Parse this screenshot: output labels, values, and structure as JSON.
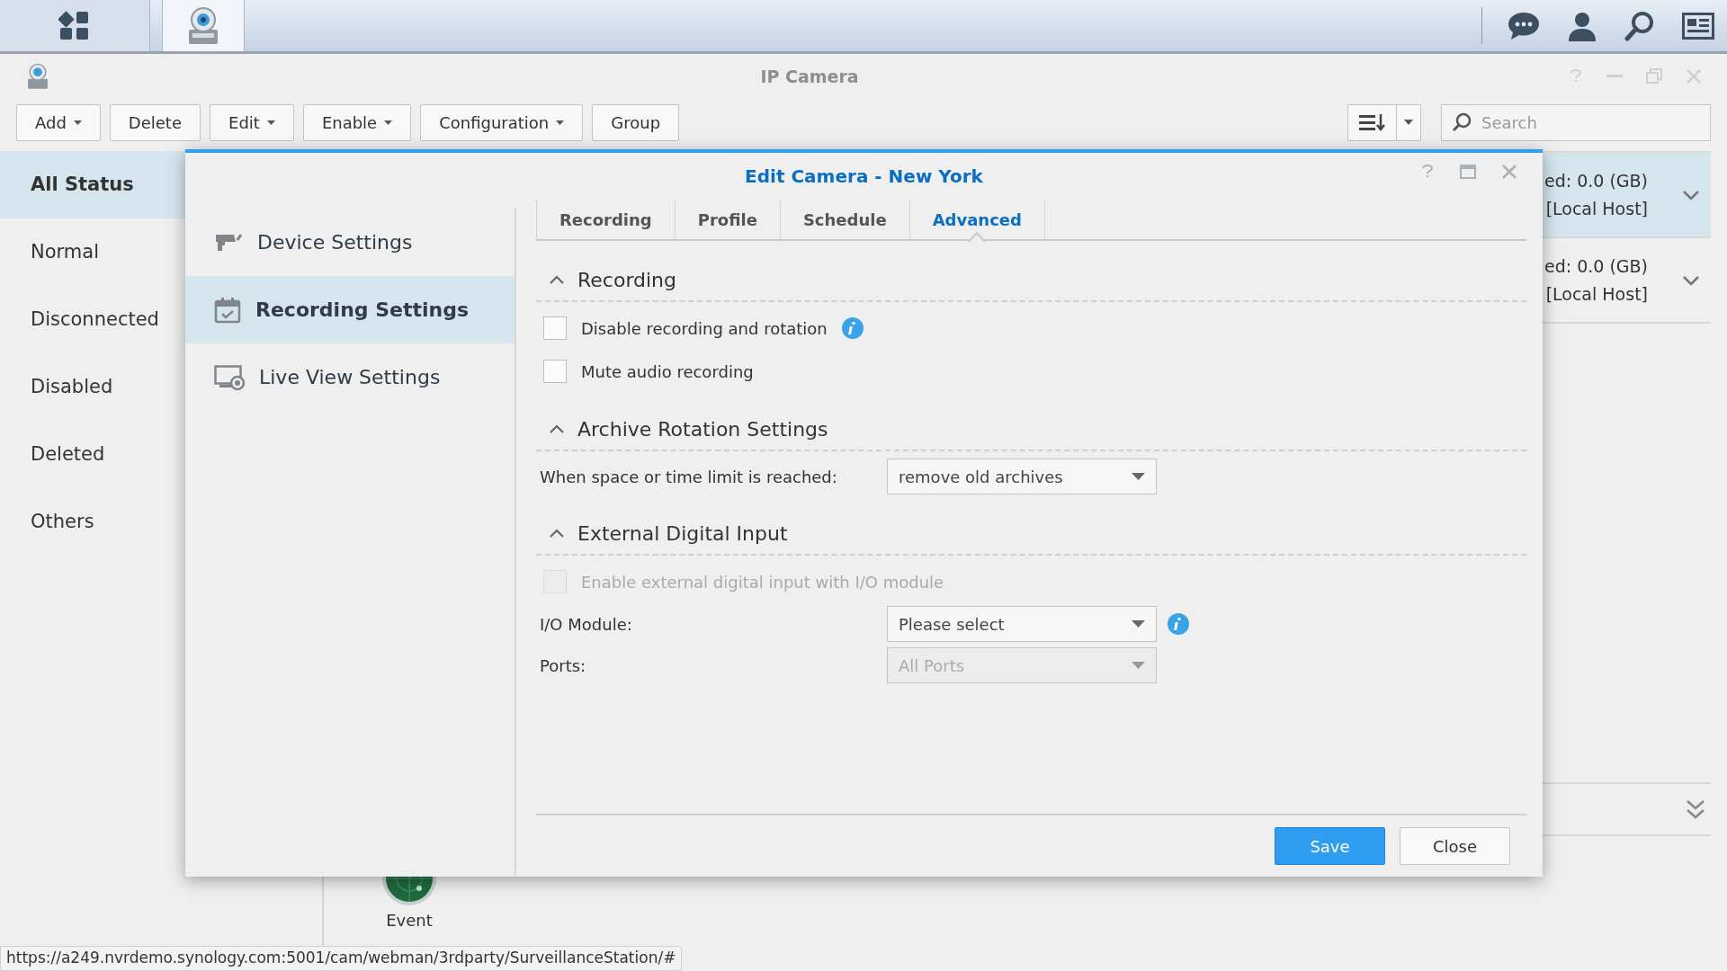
{
  "window": {
    "title": "IP Camera"
  },
  "toolbar": {
    "buttons": [
      {
        "label": "Add",
        "dropdown": true
      },
      {
        "label": "Delete",
        "dropdown": false
      },
      {
        "label": "Edit",
        "dropdown": true
      },
      {
        "label": "Enable",
        "dropdown": true
      },
      {
        "label": "Configuration",
        "dropdown": true
      },
      {
        "label": "Group",
        "dropdown": false
      }
    ],
    "search": {
      "placeholder": "Search"
    }
  },
  "sidebar": {
    "items": [
      {
        "label": "All Status",
        "selected": true
      },
      {
        "label": "Normal",
        "selected": false
      },
      {
        "label": "Disconnected",
        "selected": false
      },
      {
        "label": "Disabled",
        "selected": false
      },
      {
        "label": "Deleted",
        "selected": false
      },
      {
        "label": "Others",
        "selected": false
      }
    ]
  },
  "camera_list": {
    "rows": [
      {
        "usage": "ed: 0.0 (GB)",
        "host": "[Local Host]",
        "selected": true
      },
      {
        "usage": "ed: 0.0 (GB)",
        "host": "[Local Host]",
        "selected": false
      }
    ]
  },
  "launcher": {
    "label": "Event"
  },
  "dialog": {
    "title": "Edit Camera - New York",
    "nav": [
      {
        "label": "Device Settings",
        "selected": false
      },
      {
        "label": "Recording Settings",
        "selected": true
      },
      {
        "label": "Live View Settings",
        "selected": false
      }
    ],
    "tabs": [
      {
        "label": "Recording",
        "selected": false
      },
      {
        "label": "Profile",
        "selected": false
      },
      {
        "label": "Schedule",
        "selected": false
      },
      {
        "label": "Advanced",
        "selected": true
      }
    ],
    "sections": [
      {
        "title": "Recording",
        "expanded": true,
        "rows": [
          {
            "kind": "checkbox",
            "label": "Disable recording and rotation",
            "checked": false,
            "disabled": false,
            "info": true
          },
          {
            "kind": "checkbox",
            "label": "Mute audio recording",
            "checked": false,
            "disabled": false
          }
        ]
      },
      {
        "title": "Archive Rotation Settings",
        "expanded": true,
        "rows": [
          {
            "kind": "select",
            "label": "When space or time limit is reached:",
            "value": "remove old archives",
            "disabled": false
          }
        ]
      },
      {
        "title": "External Digital Input",
        "expanded": true,
        "rows": [
          {
            "kind": "checkbox",
            "label": "Enable external digital input with I/O module",
            "checked": false,
            "disabled": true
          },
          {
            "kind": "select",
            "label": "I/O Module:",
            "value": "Please select",
            "disabled": false,
            "info": true
          },
          {
            "kind": "select",
            "label": "Ports:",
            "value": "All Ports",
            "disabled": true
          }
        ]
      }
    ],
    "buttons": [
      {
        "label": "Save",
        "kind": "primary"
      },
      {
        "label": "Close",
        "kind": "default"
      }
    ]
  },
  "status_bar": {
    "url": "https://a249.nvrdemo.synology.com:5001/cam/webman/3rdparty/SurveillanceStation/#"
  }
}
